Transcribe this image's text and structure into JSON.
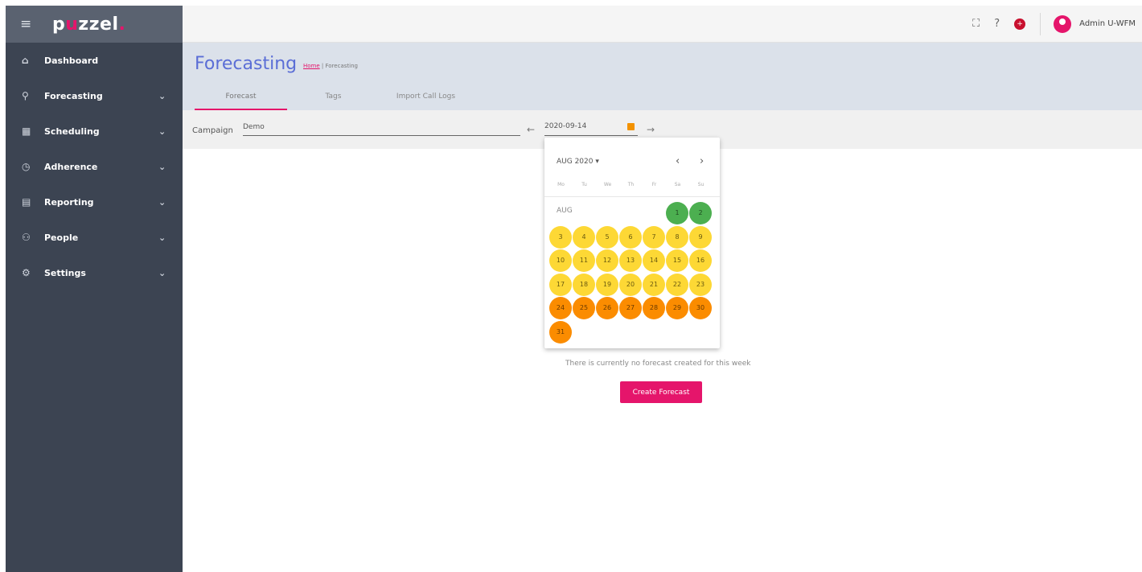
{
  "app": {
    "logo_text": "pzzel",
    "logo_accent": "u",
    "logo_full": "puzzel."
  },
  "sidebar": {
    "items": [
      {
        "label": "Dashboard",
        "icon": "home-icon",
        "expandable": false
      },
      {
        "label": "Forecasting",
        "icon": "forecast-icon",
        "expandable": true
      },
      {
        "label": "Scheduling",
        "icon": "calendar-icon",
        "expandable": true
      },
      {
        "label": "Adherence",
        "icon": "clock-icon",
        "expandable": true
      },
      {
        "label": "Reporting",
        "icon": "report-icon",
        "expandable": true
      },
      {
        "label": "People",
        "icon": "people-icon",
        "expandable": true
      },
      {
        "label": "Settings",
        "icon": "gear-icon",
        "expandable": true
      }
    ]
  },
  "topbar": {
    "user": "Admin U-WFM"
  },
  "page": {
    "title": "Forecasting",
    "breadcrumb_home": "Home",
    "breadcrumb_sep": "|",
    "breadcrumb_current": "Forecasting",
    "tabs": [
      "Forecast",
      "Tags",
      "Import Call Logs"
    ]
  },
  "filters": {
    "campaign_label": "Campaign",
    "campaign_value": "Demo",
    "date_value": "2020-09-14"
  },
  "calendar": {
    "month_label": "AUG 2020",
    "weekdays": [
      "Mo",
      "Tu",
      "We",
      "Th",
      "Fr",
      "Sa",
      "Su"
    ],
    "section_label": "AUG",
    "days": [
      {
        "d": "1",
        "c": "green"
      },
      {
        "d": "2",
        "c": "green"
      },
      {
        "d": "3",
        "c": "yellow"
      },
      {
        "d": "4",
        "c": "yellow"
      },
      {
        "d": "5",
        "c": "yellow"
      },
      {
        "d": "6",
        "c": "yellow"
      },
      {
        "d": "7",
        "c": "yellow"
      },
      {
        "d": "8",
        "c": "yellow"
      },
      {
        "d": "9",
        "c": "yellow"
      },
      {
        "d": "10",
        "c": "yellow"
      },
      {
        "d": "11",
        "c": "yellow"
      },
      {
        "d": "12",
        "c": "yellow"
      },
      {
        "d": "13",
        "c": "yellow"
      },
      {
        "d": "14",
        "c": "yellow"
      },
      {
        "d": "15",
        "c": "yellow"
      },
      {
        "d": "16",
        "c": "yellow"
      },
      {
        "d": "17",
        "c": "yellow"
      },
      {
        "d": "18",
        "c": "yellow"
      },
      {
        "d": "19",
        "c": "yellow"
      },
      {
        "d": "20",
        "c": "yellow"
      },
      {
        "d": "21",
        "c": "yellow"
      },
      {
        "d": "22",
        "c": "yellow"
      },
      {
        "d": "23",
        "c": "yellow"
      },
      {
        "d": "24",
        "c": "orange"
      },
      {
        "d": "25",
        "c": "orange"
      },
      {
        "d": "26",
        "c": "orange"
      },
      {
        "d": "27",
        "c": "orange"
      },
      {
        "d": "28",
        "c": "orange"
      },
      {
        "d": "29",
        "c": "orange"
      },
      {
        "d": "30",
        "c": "orange"
      },
      {
        "d": "31",
        "c": "orange"
      }
    ]
  },
  "main": {
    "empty_message": "There is currently no forecast created for this week",
    "create_button": "Create Forecast"
  },
  "colors": {
    "accent": "#e5156b",
    "sidebar": "#3c4452",
    "title": "#5b6ed6",
    "green": "#4caf50",
    "yellow": "#fdd835",
    "orange": "#fb8c00"
  }
}
